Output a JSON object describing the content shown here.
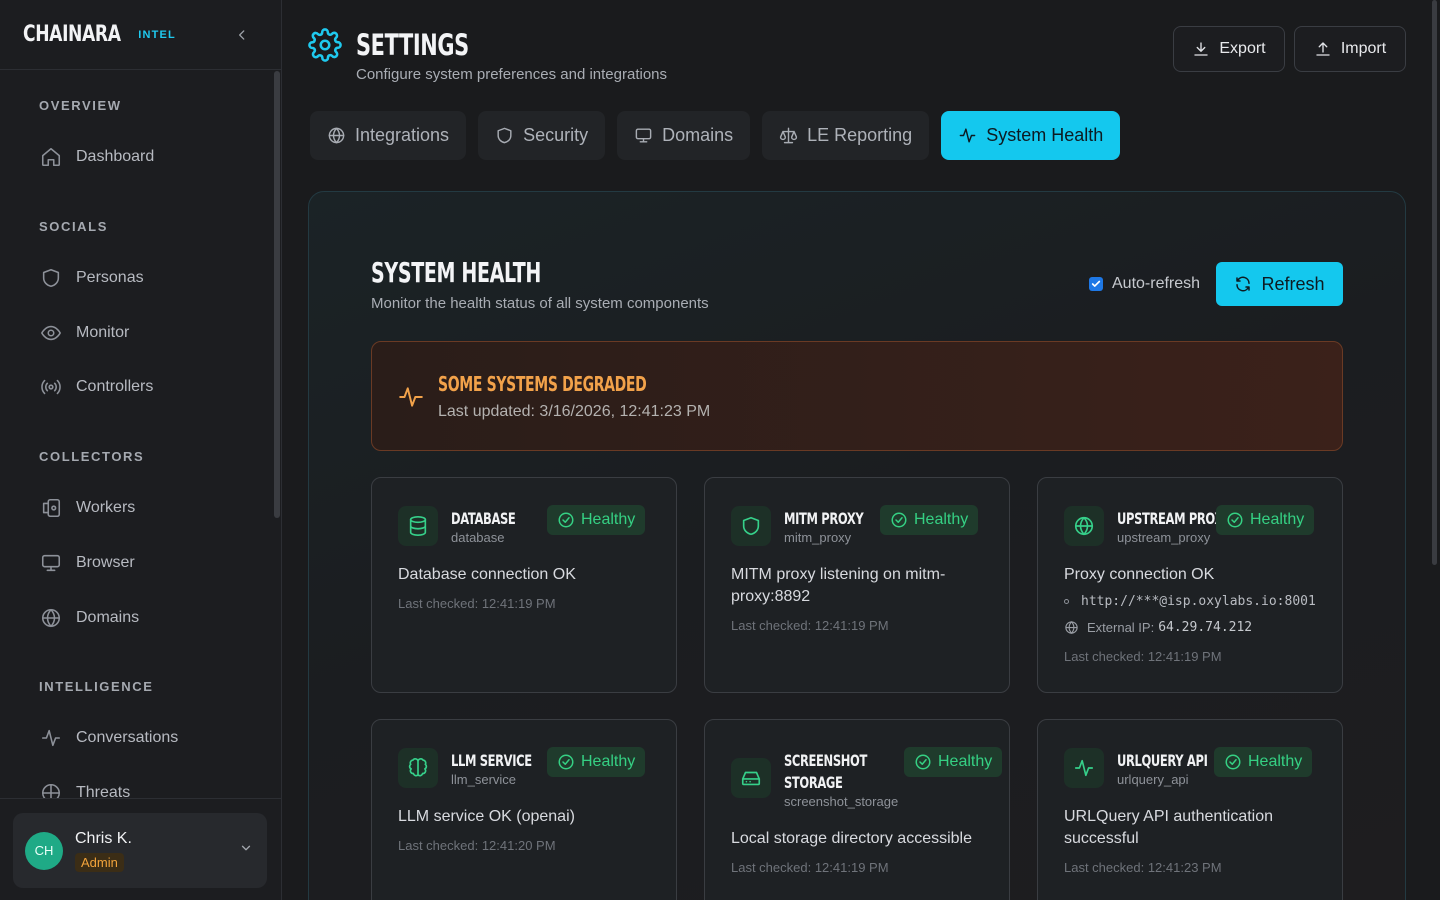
{
  "brand": {
    "name": "CHAINARA",
    "tag": "INTEL"
  },
  "sidebar": {
    "sections": [
      {
        "title": "OVERVIEW"
      },
      {
        "title": "SOCIALS"
      },
      {
        "title": "COLLECTORS"
      },
      {
        "title": "INTELLIGENCE"
      }
    ],
    "items": [
      {
        "label": "Dashboard",
        "icon": "home-icon"
      },
      {
        "label": "Personas",
        "icon": "shield-icon"
      },
      {
        "label": "Monitor",
        "icon": "eye-icon"
      },
      {
        "label": "Controllers",
        "icon": "radio-icon"
      },
      {
        "label": "Workers",
        "icon": "workers-icon"
      },
      {
        "label": "Browser",
        "icon": "monitor-icon"
      },
      {
        "label": "Domains",
        "icon": "globe-icon"
      },
      {
        "label": "Conversations",
        "icon": "activity-icon"
      },
      {
        "label": "Threats",
        "icon": "threats-icon"
      }
    ]
  },
  "user": {
    "initials": "CH",
    "name": "Chris K.",
    "role": "Admin"
  },
  "header": {
    "title": "SETTINGS",
    "subtitle": "Configure system preferences and integrations",
    "export_label": "Export",
    "import_label": "Import"
  },
  "tabs": [
    {
      "label": "Integrations",
      "icon": "globe-icon"
    },
    {
      "label": "Security",
      "icon": "shield-icon"
    },
    {
      "label": "Domains",
      "icon": "monitor-icon"
    },
    {
      "label": "LE Reporting",
      "icon": "scale-icon"
    },
    {
      "label": "System Health",
      "icon": "activity-icon",
      "active": true
    }
  ],
  "system_health": {
    "title": "SYSTEM HEALTH",
    "subtitle": "Monitor the health status of all system components",
    "auto_refresh_label": "Auto-refresh",
    "auto_refresh_checked": true,
    "refresh_label": "Refresh",
    "alert": {
      "title": "SOME SYSTEMS DEGRADED",
      "updated": "Last updated: 3/16/2026, 12:41:23 PM"
    },
    "cards": [
      {
        "name": "DATABASE",
        "id": "database",
        "status": "Healthy",
        "message": "Database connection OK",
        "checked": "Last checked: 12:41:19 PM",
        "icon": "database-icon"
      },
      {
        "name": "MITM PROXY",
        "id": "mitm_proxy",
        "status": "Healthy",
        "message": "MITM proxy listening on mitm-proxy:8892",
        "checked": "Last checked: 12:41:19 PM",
        "icon": "shield-icon"
      },
      {
        "name": "UPSTREAM PROXY",
        "id": "upstream_proxy",
        "status": "Healthy",
        "message": "Proxy connection OK",
        "proxy_url": "http://***@isp.oxylabs.io:8001",
        "external_ip_label": "External IP:",
        "external_ip": "64.29.74.212",
        "checked": "Last checked: 12:41:19 PM",
        "icon": "globe-icon"
      },
      {
        "name": "LLM SERVICE",
        "id": "llm_service",
        "status": "Healthy",
        "message": "LLM service OK (openai)",
        "checked": "Last checked: 12:41:20 PM",
        "icon": "brain-icon"
      },
      {
        "name": "SCREENSHOT",
        "name2": "STORAGE",
        "id": "screenshot_storage",
        "status": "Healthy",
        "message": "Local storage directory accessible",
        "checked": "Last checked: 12:41:19 PM",
        "icon": "hard-drive-icon"
      },
      {
        "name": "URLQUERY API",
        "id": "urlquery_api",
        "status": "Healthy",
        "message": "URLQuery API authentication successful",
        "checked": "Last checked: 12:41:23 PM",
        "icon": "activity-icon"
      }
    ]
  },
  "colors": {
    "accent": "#14c8ee",
    "healthy": "#35d083",
    "warning": "#f2a24a",
    "admin": "#f2a33b"
  }
}
